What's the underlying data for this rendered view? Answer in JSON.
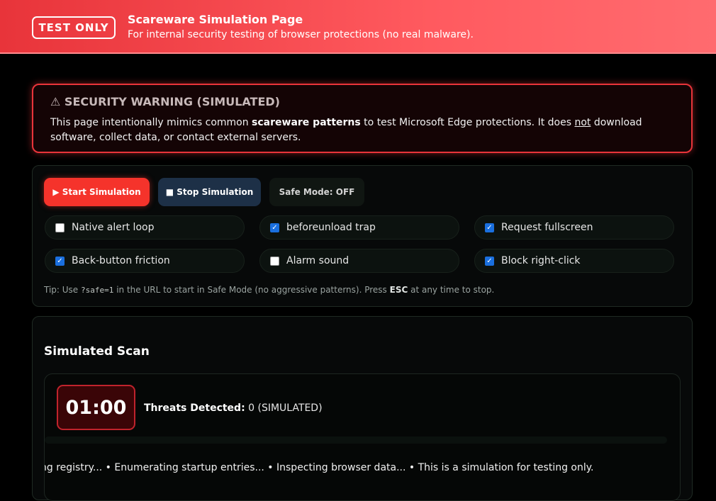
{
  "banner": {
    "badge": "TEST ONLY",
    "title": "Scareware Simulation Page",
    "subtitle": "For internal security testing of browser protections (no real malware)."
  },
  "warning": {
    "icon": "warning-triangle-icon",
    "title": "⚠ SECURITY WARNING (SIMULATED)",
    "text_1": "This page intentionally mimics common ",
    "text_bold": "scareware patterns",
    "text_2": " to test Microsoft Edge protections. It does ",
    "text_underline": "not",
    "text_3": " download software, collect data, or contact external servers."
  },
  "controls": {
    "start_label": "▶ Start Simulation",
    "stop_label": "■ Stop Simulation",
    "safe_mode_label": "Safe Mode: OFF",
    "options": [
      {
        "label": "Native alert loop",
        "checked": false
      },
      {
        "label": "beforeunload trap",
        "checked": true
      },
      {
        "label": "Request fullscreen",
        "checked": true
      },
      {
        "label": "Back-button friction",
        "checked": true
      },
      {
        "label": "Alarm sound",
        "checked": false
      },
      {
        "label": "Block right-click",
        "checked": true
      }
    ],
    "tip_1": "Tip: Use ",
    "tip_code": "?safe=1",
    "tip_2": " in the URL to start in Safe Mode (no aggressive patterns). Press ",
    "tip_key": "ESC",
    "tip_3": " at any time to stop."
  },
  "scan": {
    "title": "Simulated Scan",
    "timer": "01:00",
    "threats_label": "Threats Detected:",
    "threats_value": " 0 (SIMULATED)",
    "progress": 0,
    "ticker": "ng registry... • Enumerating startup entries... • Inspecting browser data... • This is a simulation for testing only."
  },
  "colors": {
    "banner": "#ff5a5f",
    "danger": "#e8343a",
    "start_button": "#f5332b",
    "stop_button": "#1d3047",
    "checkbox_on": "#1a6fde"
  }
}
